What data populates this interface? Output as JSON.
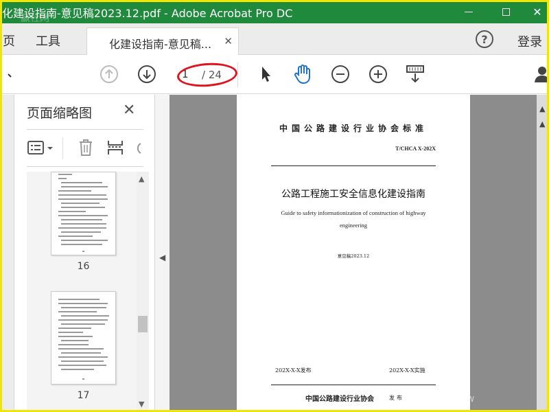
{
  "window": {
    "title": "化建设指南-意见稿2023.12.pdf - Adobe Acrobat Pro DC",
    "watermark_text": "赢社网",
    "title_bar_color": "#1f8a3c"
  },
  "tabs": {
    "home_label": "页",
    "tools_label": "工具",
    "document_tab_label": "化建设指南-意见稿...",
    "help_label": "?",
    "login_label": "登录"
  },
  "toolbar": {
    "current_page": "1",
    "total_pages": "/ 24",
    "highlight_color": "#e0141d"
  },
  "thumbnail_panel": {
    "title": "页面缩略图",
    "pages": [
      {
        "label": "16"
      },
      {
        "label": "17"
      }
    ]
  },
  "document_page": {
    "organization": "中国公路建设行业协会标准",
    "code": "T/CHCA   X-202X",
    "title": "公路工程施工安全信息化建设指南",
    "english_title": "Guide to safety informationization of construction of highway engineering",
    "draft_note": "意见稿2023.12",
    "publish_date": "202X-X-X发布",
    "implement_date": "202X-X-X实施",
    "publisher": "中国公路建设行业协会",
    "issued": "发布"
  },
  "watermark_url": "www"
}
